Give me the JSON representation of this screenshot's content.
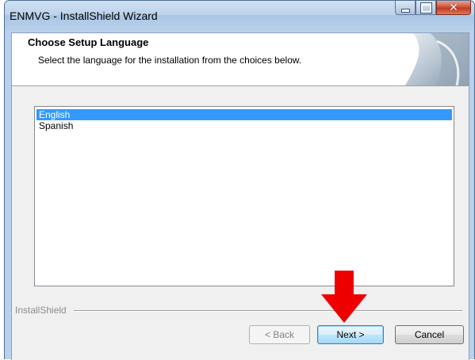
{
  "window": {
    "title": "ENMVG - InstallShield Wizard",
    "accent": "#b9d1ea"
  },
  "header": {
    "title": "Choose Setup Language",
    "subtitle": "Select the language for the installation from the choices below."
  },
  "language_list": {
    "items": [
      {
        "label": "English",
        "selected": true
      },
      {
        "label": "Spanish",
        "selected": false
      }
    ],
    "selection_color": "#3399ff"
  },
  "footer": {
    "brand": "InstallShield"
  },
  "buttons": {
    "back_label": "< Back",
    "next_label": "Next >",
    "cancel_label": "Cancel"
  },
  "annotation": {
    "arrow_color": "#ee0000",
    "arrow_icon": "down-arrow-icon"
  }
}
